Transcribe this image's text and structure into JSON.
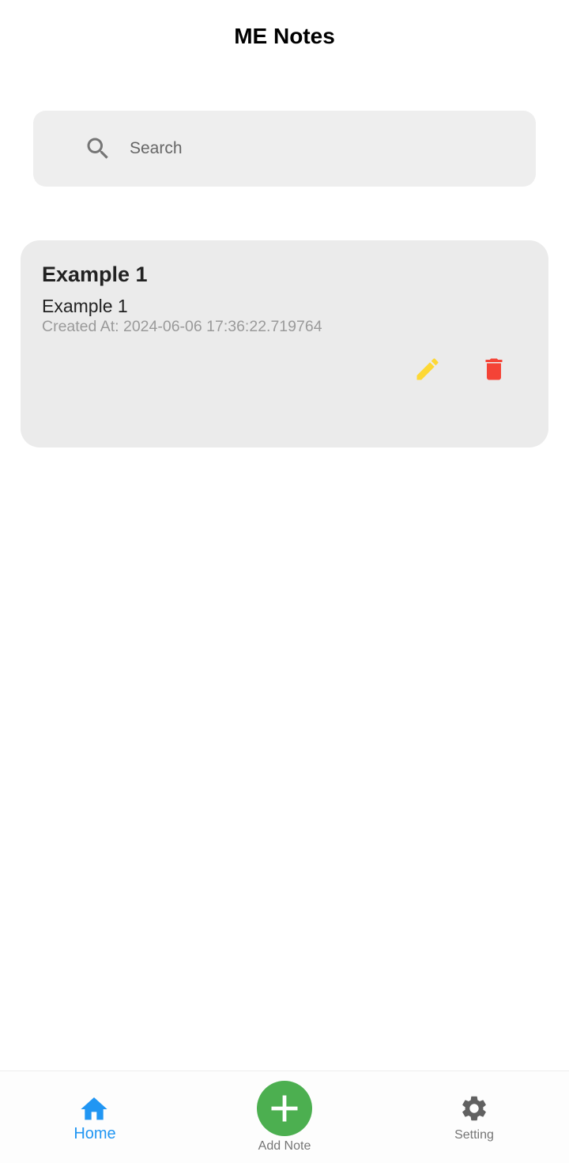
{
  "app": {
    "title": "ME Notes"
  },
  "search": {
    "placeholder": "Search",
    "value": ""
  },
  "notes": [
    {
      "title": "Example 1",
      "content": "Example 1",
      "created_at": "Created At: 2024-06-06 17:36:22.719764",
      "edit_icon": "pencil-icon",
      "delete_icon": "trash-icon"
    }
  ],
  "nav": {
    "items": [
      {
        "label": "Home",
        "icon": "home-icon",
        "active": true
      },
      {
        "label": "Add Note",
        "icon": "plus-icon",
        "active": false
      },
      {
        "label": "Setting",
        "icon": "gear-icon",
        "active": false
      }
    ]
  },
  "colors": {
    "active": "#2196f3",
    "inactive": "#757575",
    "add": "#4caf50",
    "edit": "#fdd835",
    "delete": "#f44336",
    "card": "#ebebeb",
    "search_bg": "#eeeeee"
  }
}
